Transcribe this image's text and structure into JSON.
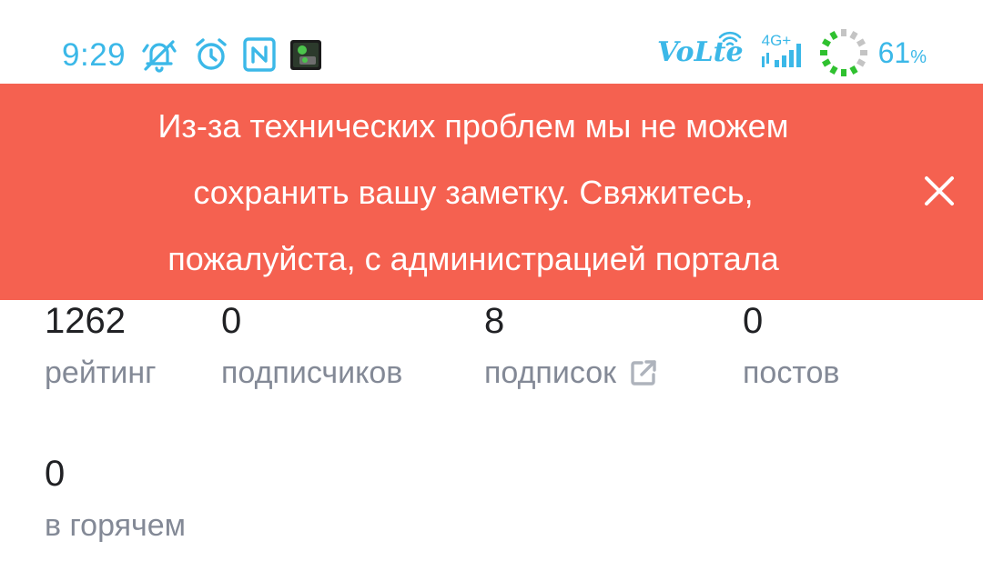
{
  "status_bar": {
    "time": "9:29",
    "network_type": "4G+",
    "volte_label": "VoLte",
    "battery_percent": "61",
    "battery_unit": "%",
    "accent_color": "#3bb8e8",
    "icons": [
      "mute-icon",
      "alarm-icon",
      "nfc-icon",
      "app-notification-icon",
      "volte-icon",
      "wifi-icon",
      "signal-icon",
      "battery-ring-icon"
    ]
  },
  "error_toast": {
    "message_lines": [
      "Из-за технических проблем мы не можем",
      "сохранить вашу заметку. Свяжитесь,",
      "пожалуйста, с администрацией портала"
    ],
    "close_icon": "close-icon",
    "background_color": "#f56150"
  },
  "profile_stats": {
    "items": [
      {
        "value": "1262",
        "label": "рейтинг"
      },
      {
        "value": "0",
        "label": "подписчиков"
      },
      {
        "value": "8",
        "label": "подписок",
        "icon": "external-link-icon"
      },
      {
        "value": "0",
        "label": "постов"
      },
      {
        "value": "0",
        "label": "в горячем"
      }
    ]
  }
}
